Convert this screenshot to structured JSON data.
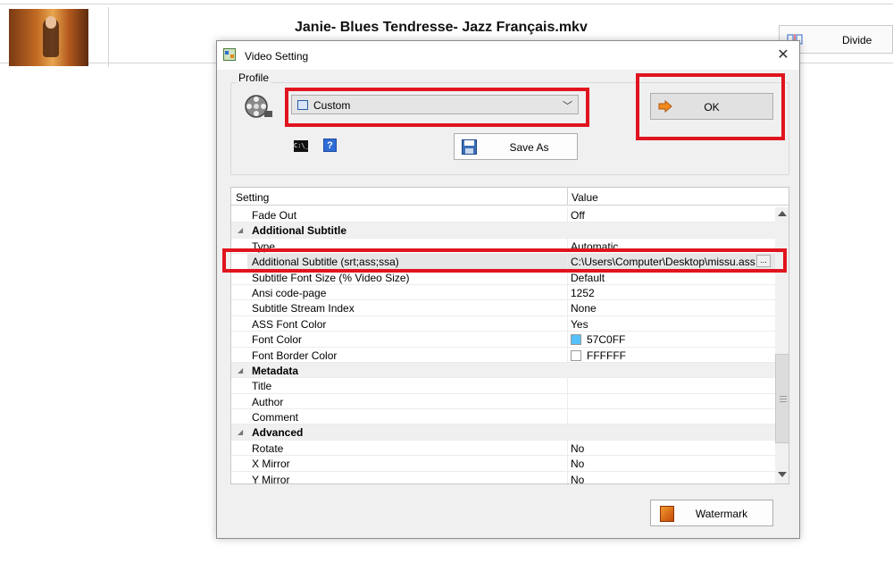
{
  "background": {
    "filename": "Janie- Blues Tendresse- Jazz Français.mkv",
    "divide_label": "Divide"
  },
  "dialog": {
    "title": "Video Setting",
    "close_glyph": "✕",
    "profile": {
      "group_label": "Profile",
      "selected": "Custom",
      "save_as_label": "Save As",
      "ok_label": "OK",
      "help_glyph": "?",
      "cmd_glyph": "C:\\_"
    },
    "grid": {
      "col_setting": "Setting",
      "col_value": "Value",
      "rows": [
        {
          "kind": "item",
          "name": "Fade Out",
          "value": "Off"
        },
        {
          "kind": "category",
          "name": "Additional Subtitle",
          "value": ""
        },
        {
          "kind": "item",
          "name": "Type",
          "value": "Automatic"
        },
        {
          "kind": "item",
          "name": "Additional Subtitle (srt;ass;ssa)",
          "value": "C:\\Users\\Computer\\Desktop\\missu.ass",
          "selected": true,
          "ellipsis": "..."
        },
        {
          "kind": "item",
          "name": "Subtitle Font Size (% Video Size)",
          "value": "Default"
        },
        {
          "kind": "item",
          "name": "Ansi code-page",
          "value": "1252"
        },
        {
          "kind": "item",
          "name": "Subtitle Stream Index",
          "value": "None"
        },
        {
          "kind": "item",
          "name": "ASS Font Color",
          "value": "Yes"
        },
        {
          "kind": "item",
          "name": "Font Color",
          "value": "57C0FF",
          "swatch": "#57C0FF"
        },
        {
          "kind": "item",
          "name": "Font Border Color",
          "value": "FFFFFF",
          "swatch": "#FFFFFF"
        },
        {
          "kind": "category",
          "name": "Metadata",
          "value": ""
        },
        {
          "kind": "item",
          "name": "Title",
          "value": ""
        },
        {
          "kind": "item",
          "name": "Author",
          "value": ""
        },
        {
          "kind": "item",
          "name": "Comment",
          "value": ""
        },
        {
          "kind": "category",
          "name": "Advanced",
          "value": ""
        },
        {
          "kind": "item",
          "name": "Rotate",
          "value": "No"
        },
        {
          "kind": "item",
          "name": "X Mirror",
          "value": "No"
        },
        {
          "kind": "item",
          "name": "Y Mirror",
          "value": "No"
        }
      ]
    },
    "watermark_label": "Watermark"
  },
  "colors": {
    "highlight_red": "#E0141E",
    "ok_arrow": "#F28A1E"
  }
}
